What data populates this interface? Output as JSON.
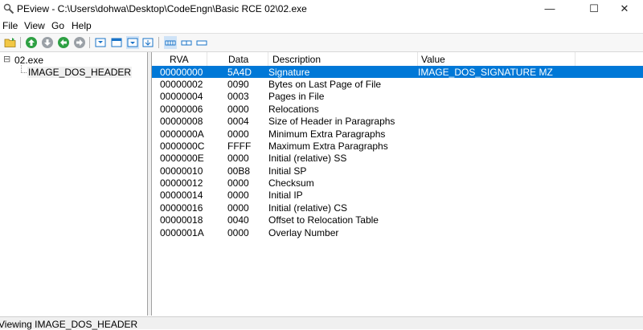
{
  "window": {
    "title": "PEview - C:\\Users\\dohwa\\Desktop\\CodeEngn\\Basic RCE 02\\02.exe",
    "minimize": "—",
    "maximize": "☐",
    "close": "✕"
  },
  "menu": [
    "File",
    "View",
    "Go",
    "Help"
  ],
  "toolbar": {
    "icons": [
      "open-folder-icon",
      "go-up-icon",
      "go-down-icon",
      "go-back-icon",
      "go-forward-icon",
      "view-tile1-icon",
      "view-tile2-icon",
      "view-tile3-icon",
      "view-tile4-icon",
      "bytes-icon",
      "words-icon",
      "dwords-icon"
    ]
  },
  "tree": {
    "root": {
      "toggle": "⊟",
      "label": "02.exe"
    },
    "children": [
      {
        "label": "IMAGE_DOS_HEADER"
      }
    ]
  },
  "list": {
    "columns": [
      "RVA",
      "Data",
      "Description",
      "Value"
    ],
    "rows": [
      {
        "rva": "00000000",
        "data": "5A4D",
        "desc": "Signature",
        "value": "IMAGE_DOS_SIGNATURE  MZ",
        "selected": true
      },
      {
        "rva": "00000002",
        "data": "0090",
        "desc": "Bytes on Last Page of File",
        "value": ""
      },
      {
        "rva": "00000004",
        "data": "0003",
        "desc": "Pages in File",
        "value": ""
      },
      {
        "rva": "00000006",
        "data": "0000",
        "desc": "Relocations",
        "value": ""
      },
      {
        "rva": "00000008",
        "data": "0004",
        "desc": "Size of Header in Paragraphs",
        "value": ""
      },
      {
        "rva": "0000000A",
        "data": "0000",
        "desc": "Minimum Extra Paragraphs",
        "value": ""
      },
      {
        "rva": "0000000C",
        "data": "FFFF",
        "desc": "Maximum Extra Paragraphs",
        "value": ""
      },
      {
        "rva": "0000000E",
        "data": "0000",
        "desc": "Initial (relative) SS",
        "value": ""
      },
      {
        "rva": "00000010",
        "data": "00B8",
        "desc": "Initial SP",
        "value": ""
      },
      {
        "rva": "00000012",
        "data": "0000",
        "desc": "Checksum",
        "value": ""
      },
      {
        "rva": "00000014",
        "data": "0000",
        "desc": "Initial IP",
        "value": ""
      },
      {
        "rva": "00000016",
        "data": "0000",
        "desc": "Initial (relative) CS",
        "value": ""
      },
      {
        "rva": "00000018",
        "data": "0040",
        "desc": "Offset to Relocation Table",
        "value": ""
      },
      {
        "rva": "0000001A",
        "data": "0000",
        "desc": "Overlay Number",
        "value": ""
      }
    ]
  },
  "status": "Viewing IMAGE_DOS_HEADER",
  "colors": {
    "selection": "#0078d7",
    "green": "#2ea043",
    "blue": "#1a73c7"
  }
}
